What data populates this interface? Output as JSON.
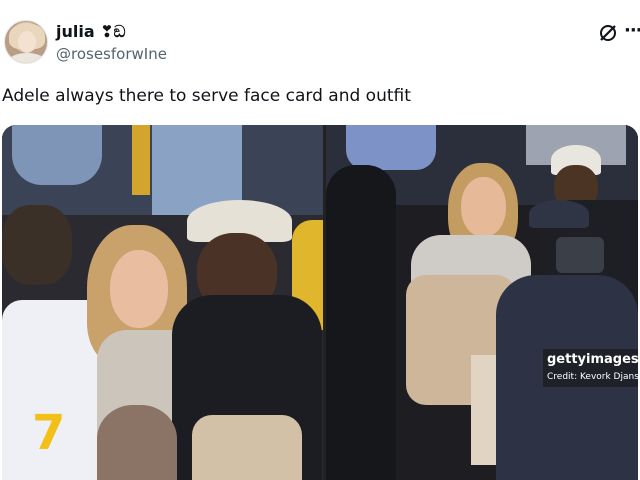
{
  "author": {
    "display_name": "julia ❣ඞ",
    "handle": "@rosesforwIne"
  },
  "tweet": {
    "text": "Adele always there to serve face card and outfit"
  },
  "header_icons": {
    "grok": "grok-icon",
    "more": "more-options-icon",
    "more_glyph": "···"
  },
  "media": {
    "count": 2,
    "watermark": {
      "logo": "gettyimages",
      "credit": "Credit: Kevork Djansezian"
    }
  },
  "colors": {
    "text": "#0f1419",
    "secondary_text": "#536471",
    "background": "#ffffff"
  }
}
